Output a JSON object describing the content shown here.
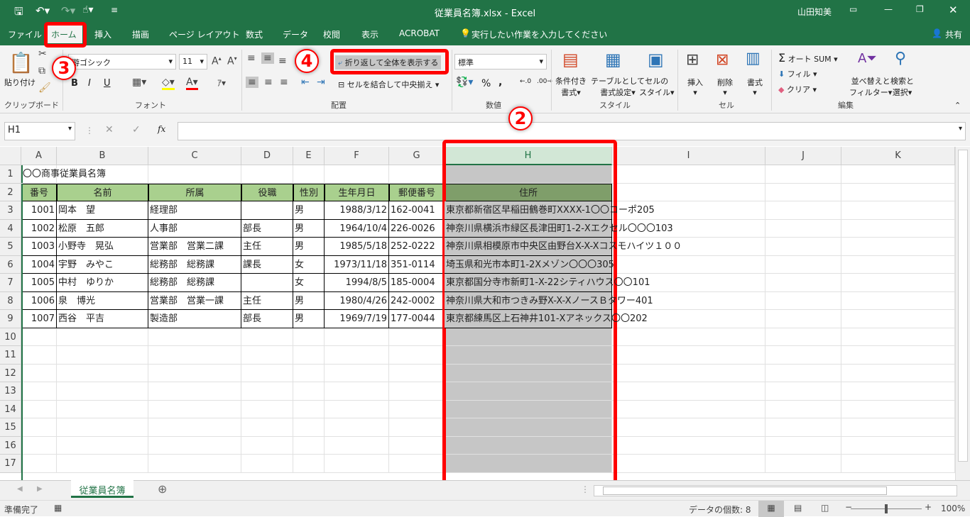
{
  "window": {
    "title": "従業員名簿.xlsx  -  Excel",
    "user": "山田知美"
  },
  "ribbon_tabs": [
    "ファイル",
    "ホーム",
    "挿入",
    "描画",
    "ページ レイアウト",
    "数式",
    "データ",
    "校閲",
    "表示",
    "ACROBAT"
  ],
  "tell_me": "実行したい作業を入力してください",
  "share": "共有",
  "clipboard": {
    "paste": "貼り付け",
    "group": "クリップボード"
  },
  "font": {
    "name": "游ゴシック",
    "size": "11",
    "bold": "B",
    "italic": "I",
    "underline": "U",
    "group": "フォント"
  },
  "alignment": {
    "wrap_text": "折り返して全体を表示する",
    "merge_center": "セルを結合して中央揃え",
    "group": "配置"
  },
  "number": {
    "format": "標準",
    "percent": "%",
    "comma": ",",
    "group": "数値"
  },
  "styles": {
    "conditional": [
      "条件付き",
      "書式"
    ],
    "table": [
      "テーブルとして",
      "書式設定"
    ],
    "cell_styles": [
      "セルの",
      "スタイル"
    ],
    "group": "スタイル"
  },
  "cells": {
    "insert": "挿入",
    "delete": "削除",
    "format": "書式",
    "group": "セル"
  },
  "editing": {
    "autosum": "オート SUM",
    "fill": "フィル",
    "clear": "クリア",
    "sort": [
      "並べ替えと",
      "フィルター"
    ],
    "find": [
      "検索と",
      "選択"
    ],
    "group": "編集"
  },
  "formula_bar": {
    "name_box": "H1",
    "fx": "fx",
    "value": ""
  },
  "columns": [
    "A",
    "B",
    "C",
    "D",
    "E",
    "F",
    "G",
    "H",
    "I",
    "J",
    "K"
  ],
  "sheet": {
    "title": "〇〇商事従業員名簿",
    "headers": [
      "番号",
      "名前",
      "所属",
      "役職",
      "性別",
      "生年月日",
      "郵便番号",
      "住所"
    ],
    "rows": [
      [
        "1001",
        "岡本　望",
        "経理部",
        "",
        "男",
        "1988/3/12",
        "162-0041",
        "東京都新宿区早稲田鶴巻町XXXX-1〇〇コーポ205"
      ],
      [
        "1002",
        "松原　五郎",
        "人事部",
        "部長",
        "男",
        "1964/10/4",
        "226-0026",
        "神奈川県横浜市緑区長津田町1-2-Xエクセル〇〇〇103"
      ],
      [
        "1003",
        "小野寺　晃弘",
        "営業部　営業二課",
        "主任",
        "男",
        "1985/5/18",
        "252-0222",
        "神奈川県相模原市中央区由野台X-X-Xコスモハイツ１００"
      ],
      [
        "1004",
        "宇野　みやこ",
        "総務部　総務課",
        "課長",
        "女",
        "1973/11/18",
        "351-0114",
        "埼玉県和光市本町1-2Xメゾン〇〇〇305"
      ],
      [
        "1005",
        "中村　ゆりか",
        "総務部　総務課",
        "",
        "女",
        "1994/8/5",
        "185-0004",
        "東京都国分寺市新町1-X-22シティハウス〇〇101"
      ],
      [
        "1006",
        "泉　博光",
        "営業部　営業一課",
        "主任",
        "男",
        "1980/4/26",
        "242-0002",
        "神奈川県大和市つきみ野X-X-XノースＢタワー401"
      ],
      [
        "1007",
        "西谷　平吉",
        "製造部",
        "部長",
        "男",
        "1969/7/19",
        "177-0044",
        "東京都練馬区上石神井101-Xアネックス〇〇202"
      ]
    ]
  },
  "sheet_tab": "従業員名簿",
  "status": {
    "ready": "準備完了",
    "count": "データの個数: 8",
    "zoom": "100%",
    "zoom_fraction": 0.5
  },
  "annotations": {
    "step2": "2",
    "step3": "3",
    "step4": "4"
  },
  "colors": {
    "excel_green": "#217346",
    "header_fill": "#a9d08e",
    "highlight": "#ff0000"
  }
}
